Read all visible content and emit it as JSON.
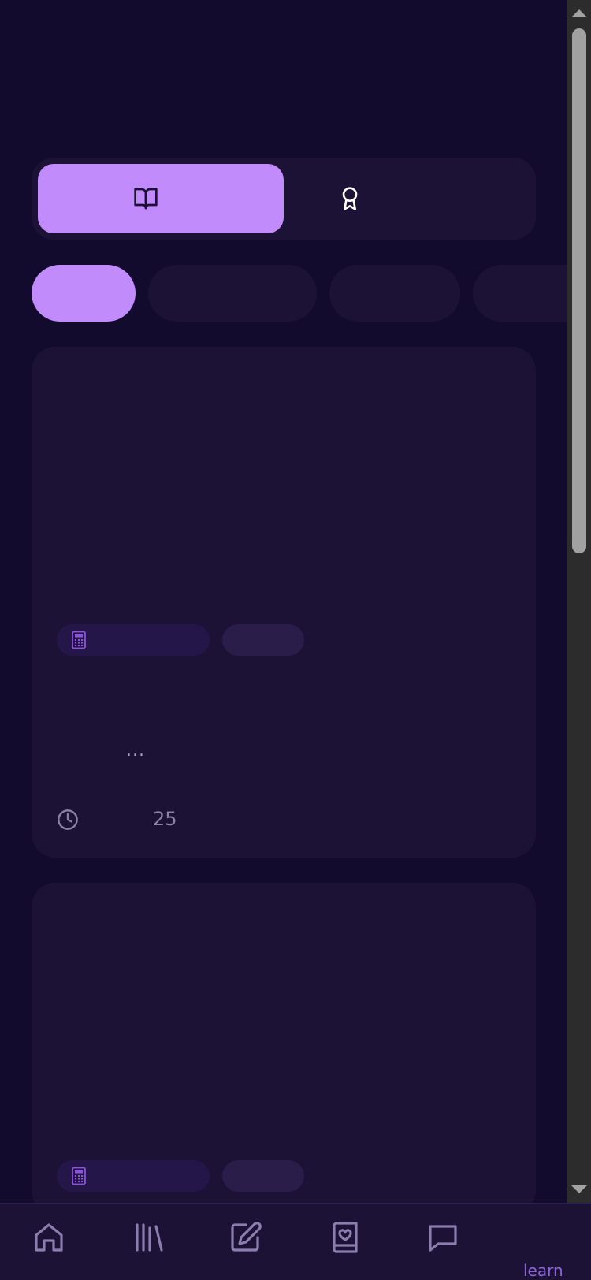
{
  "tabs": [
    {
      "icon": "book-open-icon",
      "active": true
    },
    {
      "icon": "award-icon",
      "active": false
    }
  ],
  "filters": [
    {
      "active": true
    },
    {
      "active": false
    },
    {
      "active": false
    },
    {
      "active": false
    }
  ],
  "cards": [
    {
      "subject_icon": "calculator-icon",
      "description_truncated": "...",
      "duration_value": "25"
    },
    {
      "subject_icon": "calculator-icon"
    }
  ],
  "bottom_nav": {
    "items": [
      {
        "icon": "home-icon"
      },
      {
        "icon": "library-icon"
      },
      {
        "icon": "edit-icon"
      },
      {
        "icon": "book-heart-icon"
      },
      {
        "icon": "message-icon"
      }
    ],
    "partial_label": "learn"
  },
  "colors": {
    "background": "#120b2e",
    "surface": "#1b1236",
    "accent": "#c28bfc",
    "muted_text": "#8b829f"
  }
}
